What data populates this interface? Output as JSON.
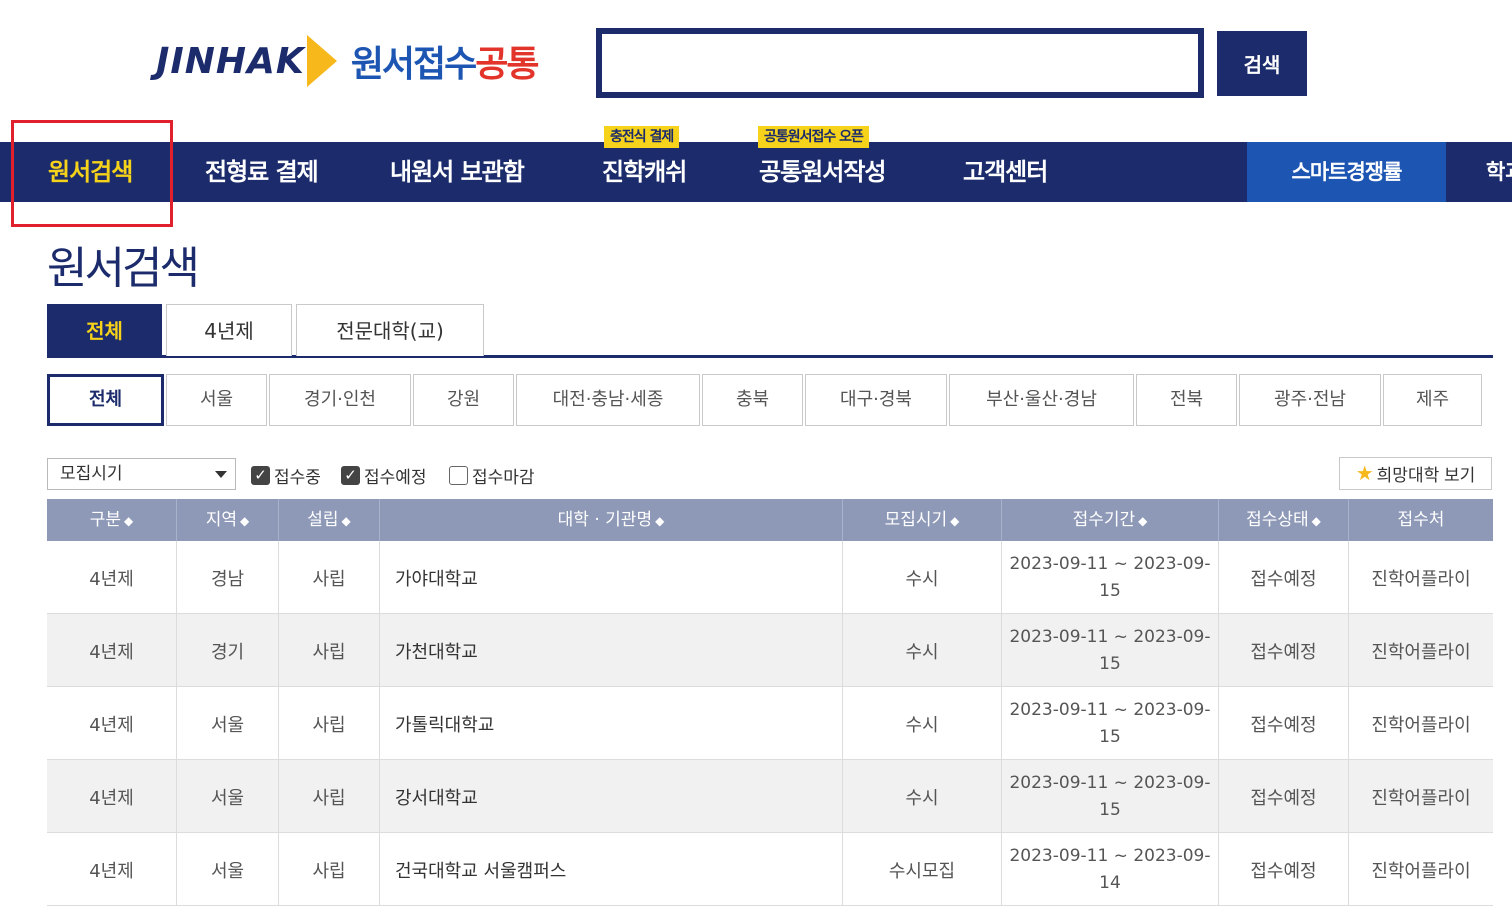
{
  "header": {
    "logo_brand": "JINHAK",
    "logo_text_blue": "원서접수",
    "logo_text_red": "공통",
    "search_value": "",
    "search_button": "검색"
  },
  "nav": {
    "items": [
      "원서검색",
      "전형료 결제",
      "내원서 보관함",
      "진학캐쉬",
      "공통원서작성",
      "고객센터"
    ],
    "badges": [
      "충전식 결제",
      "공통원서접수 오픈"
    ],
    "smart": "스마트경쟁률",
    "more": "학과"
  },
  "page_title": "원서검색",
  "tabs": [
    "전체",
    "4년제",
    "전문대학(교)"
  ],
  "regions": [
    "전체",
    "서울",
    "경기·인천",
    "강원",
    "대전·충남·세종",
    "충북",
    "대구·경북",
    "부산·울산·경남",
    "전북",
    "광주·전남",
    "제주"
  ],
  "filters": {
    "select_value": "모집시기",
    "checkboxes": [
      {
        "label": "접수중",
        "checked": true
      },
      {
        "label": "접수예정",
        "checked": true
      },
      {
        "label": "접수마감",
        "checked": false
      }
    ],
    "wish_button": "희망대학 보기",
    "check_mark": "✓",
    "star": "★"
  },
  "table": {
    "columns": [
      "구분",
      "지역",
      "설립",
      "대학 · 기관명",
      "모집시기",
      "접수기간",
      "접수상태",
      "접수처"
    ],
    "sort_glyph": "◆",
    "rows": [
      [
        "4년제",
        "경남",
        "사립",
        "가야대학교",
        "수시",
        "2023-09-11 ~ 2023-09-15",
        "접수예정",
        "진학어플라이"
      ],
      [
        "4년제",
        "경기",
        "사립",
        "가천대학교",
        "수시",
        "2023-09-11 ~ 2023-09-15",
        "접수예정",
        "진학어플라이"
      ],
      [
        "4년제",
        "서울",
        "사립",
        "가톨릭대학교",
        "수시",
        "2023-09-11 ~ 2023-09-15",
        "접수예정",
        "진학어플라이"
      ],
      [
        "4년제",
        "서울",
        "사립",
        "강서대학교",
        "수시",
        "2023-09-11 ~ 2023-09-15",
        "접수예정",
        "진학어플라이"
      ],
      [
        "4년제",
        "서울",
        "사립",
        "건국대학교 서울캠퍼스",
        "수시모집",
        "2023-09-11 ~ 2023-09-14",
        "접수예정",
        "진학어플라이"
      ]
    ]
  },
  "colors": {
    "navy": "#1b2b6b",
    "accent_yellow": "#f6d31a",
    "smart_blue": "#1d55b3",
    "highlight_red": "#e0202c",
    "table_header": "#8e99b7"
  }
}
